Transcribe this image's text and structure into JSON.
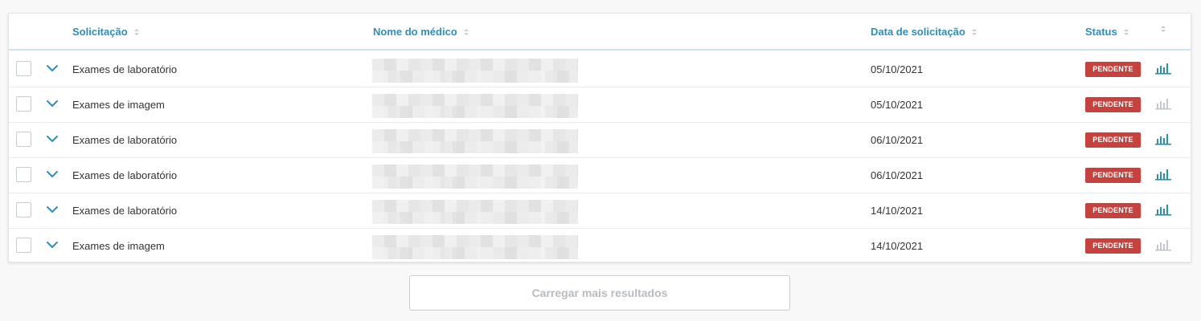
{
  "table": {
    "headers": {
      "solicitacao": "Solicitação",
      "nome_medico": "Nome do médico",
      "data_solicitacao": "Data de solicitação",
      "status": "Status"
    },
    "rows": [
      {
        "solicitacao": "Exames de laboratório",
        "data": "05/10/2021",
        "status": "PENDENTE",
        "chart_active": true
      },
      {
        "solicitacao": "Exames de imagem",
        "data": "05/10/2021",
        "status": "PENDENTE",
        "chart_active": false
      },
      {
        "solicitacao": "Exames de laboratório",
        "data": "06/10/2021",
        "status": "PENDENTE",
        "chart_active": true
      },
      {
        "solicitacao": "Exames de laboratório",
        "data": "06/10/2021",
        "status": "PENDENTE",
        "chart_active": true
      },
      {
        "solicitacao": "Exames de laboratório",
        "data": "14/10/2021",
        "status": "PENDENTE",
        "chart_active": true
      },
      {
        "solicitacao": "Exames de imagem",
        "data": "14/10/2021",
        "status": "PENDENTE",
        "chart_active": false
      }
    ]
  },
  "load_more": {
    "label": "Carregar mais resultados"
  },
  "colors": {
    "accent": "#2a8fbf",
    "status_pending": "#c9413c",
    "icon_inactive": "#c4c8cc"
  },
  "icons": {
    "sort": "sort-icon",
    "expand": "chevron-down-icon",
    "chart": "bar-chart-icon"
  }
}
